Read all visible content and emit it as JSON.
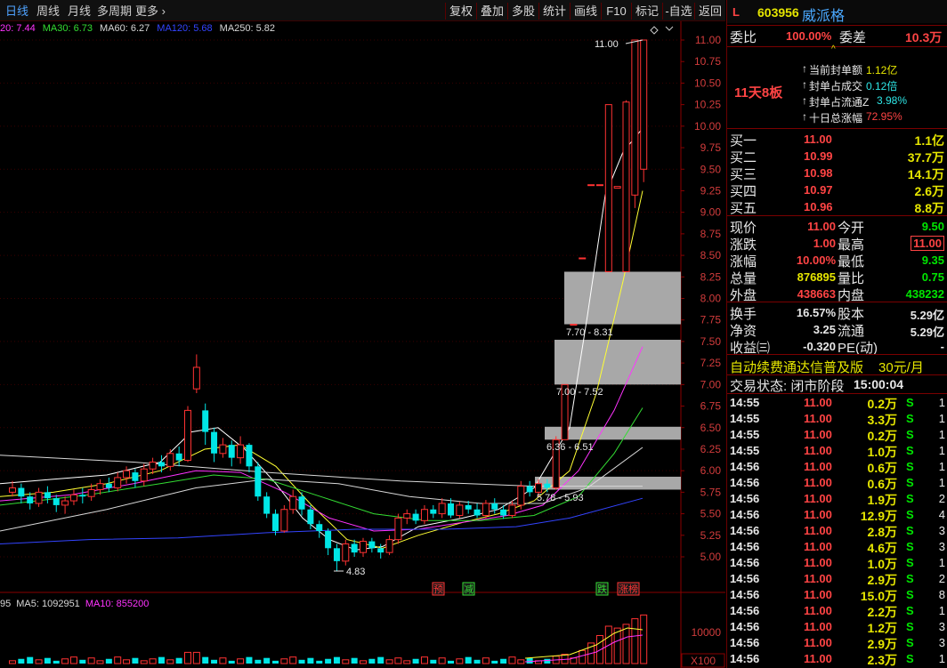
{
  "toolbar": {
    "timeframes": [
      "日线",
      "周线",
      "月线",
      "多周期",
      "更多"
    ],
    "active_timeframe": "日线",
    "more_arrow": "›",
    "buttons": [
      "复权",
      "叠加",
      "多股",
      "统计",
      "画线",
      "F10",
      "标记",
      "-自选",
      "返回"
    ]
  },
  "ma_legend": [
    {
      "label": "20: 7.44",
      "color": "#ff33ff"
    },
    {
      "label": "MA30: 6.73",
      "color": "#33dd33"
    },
    {
      "label": "MA60: 6.27",
      "color": "#d8d8d8"
    },
    {
      "label": "MA120: 5.68",
      "color": "#3344ff"
    },
    {
      "label": "MA250: 5.82",
      "color": "#d8d8d8"
    }
  ],
  "vol_legend": [
    {
      "label": "95",
      "color": "#d8d8d8"
    },
    {
      "label": "MA5: 1092951",
      "color": "#d8d8d8"
    },
    {
      "label": "MA10: 855200",
      "color": "#ff33ff"
    }
  ],
  "chart_data": {
    "type": "candlestick",
    "y_ticks": [
      "11.00",
      "10.75",
      "10.50",
      "10.25",
      "10.00",
      "9.75",
      "9.50",
      "9.25",
      "9.00",
      "8.75",
      "8.50",
      "8.25",
      "8.00",
      "7.75",
      "7.50",
      "7.25",
      "7.00",
      "6.75",
      "6.50",
      "6.25",
      "6.00",
      "5.75",
      "5.50",
      "5.25",
      "5.00"
    ],
    "ylim": [
      4.6,
      11.1
    ],
    "vol_tick": "10000",
    "vol_unit": "X100",
    "high_label": "11.00",
    "low_label": "4.83",
    "candles": [
      [
        5.75,
        5.8,
        5.7,
        5.88
      ],
      [
        5.8,
        5.7,
        5.62,
        5.85
      ],
      [
        5.7,
        5.62,
        5.55,
        5.75
      ],
      [
        5.62,
        5.75,
        5.58,
        5.8
      ],
      [
        5.75,
        5.68,
        5.62,
        5.82
      ],
      [
        5.68,
        5.6,
        5.52,
        5.72
      ],
      [
        5.6,
        5.65,
        5.5,
        5.7
      ],
      [
        5.65,
        5.72,
        5.6,
        5.78
      ],
      [
        5.72,
        5.7,
        5.62,
        5.8
      ],
      [
        5.7,
        5.78,
        5.65,
        5.85
      ],
      [
        5.78,
        5.85,
        5.72,
        5.9
      ],
      [
        5.85,
        5.8,
        5.75,
        5.92
      ],
      [
        5.8,
        5.92,
        5.76,
        5.98
      ],
      [
        5.92,
        6.0,
        5.85,
        6.05
      ],
      [
        5.98,
        5.88,
        5.8,
        6.02
      ],
      [
        5.88,
        6.02,
        5.82,
        6.08
      ],
      [
        6.02,
        6.1,
        5.96,
        6.15
      ],
      [
        6.1,
        6.05,
        5.98,
        6.18
      ],
      [
        6.05,
        6.2,
        6.0,
        6.25
      ],
      [
        6.2,
        6.12,
        6.05,
        6.28
      ],
      [
        6.12,
        6.7,
        6.1,
        6.75
      ],
      [
        6.95,
        7.2,
        6.9,
        7.35
      ],
      [
        6.7,
        6.45,
        6.3,
        6.78
      ],
      [
        6.45,
        6.2,
        6.1,
        6.5
      ],
      [
        6.2,
        6.3,
        6.15,
        6.38
      ],
      [
        6.3,
        6.15,
        6.05,
        6.35
      ],
      [
        6.15,
        6.3,
        6.08,
        6.4
      ],
      [
        6.3,
        6.05,
        5.98,
        6.32
      ],
      [
        6.05,
        5.7,
        5.65,
        6.1
      ],
      [
        5.7,
        5.5,
        5.45,
        5.75
      ],
      [
        5.5,
        5.3,
        5.25,
        5.55
      ],
      [
        5.3,
        5.55,
        5.28,
        5.6
      ],
      [
        5.55,
        5.7,
        5.5,
        5.78
      ],
      [
        5.7,
        5.55,
        5.48,
        5.75
      ],
      [
        5.55,
        5.38,
        5.32,
        5.6
      ],
      [
        5.38,
        5.3,
        5.22,
        5.42
      ],
      [
        5.3,
        5.1,
        5.02,
        5.33
      ],
      [
        5.1,
        4.95,
        4.83,
        5.15
      ],
      [
        4.95,
        5.15,
        4.9,
        5.2
      ],
      [
        5.15,
        5.05,
        5.0,
        5.2
      ],
      [
        5.05,
        5.18,
        5.0,
        5.22
      ],
      [
        5.18,
        5.1,
        5.05,
        5.22
      ],
      [
        5.1,
        5.05,
        4.98,
        5.15
      ],
      [
        5.05,
        5.2,
        5.02,
        5.25
      ],
      [
        5.2,
        5.45,
        5.15,
        5.5
      ],
      [
        5.45,
        5.5,
        5.38,
        5.55
      ],
      [
        5.5,
        5.42,
        5.38,
        5.55
      ],
      [
        5.42,
        5.55,
        5.38,
        5.6
      ],
      [
        5.55,
        5.5,
        5.45,
        5.6
      ],
      [
        5.5,
        5.62,
        5.45,
        5.68
      ],
      [
        5.62,
        5.48,
        5.45,
        5.68
      ],
      [
        5.48,
        5.6,
        5.45,
        5.64
      ],
      [
        5.6,
        5.55,
        5.5,
        5.65
      ],
      [
        5.55,
        5.48,
        5.45,
        5.62
      ],
      [
        5.48,
        5.62,
        5.44,
        5.66
      ],
      [
        5.62,
        5.55,
        5.5,
        5.68
      ],
      [
        5.55,
        5.48,
        5.44,
        5.6
      ],
      [
        5.48,
        5.6,
        5.45,
        5.65
      ],
      [
        5.6,
        5.82,
        5.55,
        5.88
      ],
      [
        5.82,
        5.75,
        5.7,
        5.88
      ],
      [
        5.75,
        5.85,
        5.7,
        5.9
      ],
      [
        5.85,
        5.8,
        5.75,
        5.9
      ],
      [
        5.8,
        6.36,
        5.78,
        6.4
      ],
      [
        6.36,
        7.0,
        6.36,
        7.0
      ],
      [
        7.7,
        7.7,
        7.7,
        7.7
      ],
      [
        8.47,
        8.47,
        8.47,
        8.47
      ],
      [
        9.32,
        9.32,
        9.32,
        9.32
      ],
      [
        9.32,
        9.32,
        9.32,
        9.32
      ],
      [
        8.31,
        10.25,
        8.31,
        10.25
      ],
      [
        9.28,
        9.3,
        9.28,
        9.3
      ],
      [
        8.31,
        10.28,
        8.31,
        10.3
      ],
      [
        9.2,
        11.0,
        9.05,
        11.0
      ],
      [
        9.5,
        11.0,
        9.35,
        11.0
      ]
    ]
  },
  "chart_annotations": {
    "box1": "7.70 - 8.31",
    "box2": "7.00 - 7.52",
    "box3": "6.36 - 6.51",
    "box4": "5.78 - 5.93",
    "markers": [
      {
        "label": "预",
        "color": "#ff3333"
      },
      {
        "label": "减",
        "color": "#33dd33"
      },
      {
        "label": "跌",
        "color": "#33dd33"
      },
      {
        "label": "涨榜",
        "color": "#ff3333"
      }
    ]
  },
  "panel": {
    "market": "L",
    "code": "603956",
    "name": "威派格",
    "weibi_label": "委比",
    "weibi_value": "100.00%",
    "weicha_label": "委差",
    "weicha_value": "10.3万",
    "streak": "11天8板",
    "seal_items": [
      {
        "label": "当前封单额",
        "value": "1.12亿",
        "color": "#e6e600"
      },
      {
        "label": "封单占成交",
        "value": "0.12倍",
        "color": "#2ee6e6"
      },
      {
        "label": "封单占流通Z",
        "value": "3.98%",
        "color": "#2ee6e6"
      },
      {
        "label": "十日总涨幅",
        "value": "72.95%",
        "color": "#ff4444"
      }
    ],
    "bids": [
      {
        "label": "买一",
        "price": "11.00",
        "vol": "1.1亿"
      },
      {
        "label": "买二",
        "price": "10.99",
        "vol": "37.7万"
      },
      {
        "label": "买三",
        "price": "10.98",
        "vol": "14.1万"
      },
      {
        "label": "买四",
        "price": "10.97",
        "vol": "2.6万"
      },
      {
        "label": "买五",
        "price": "10.96",
        "vol": "8.8万"
      }
    ],
    "quote": [
      {
        "l1": "现价",
        "v1": "11.00",
        "c1": "#ff4444",
        "l2": "今开",
        "v2": "9.50",
        "c2": "#00e600"
      },
      {
        "l1": "涨跌",
        "v1": "1.00",
        "c1": "#ff4444",
        "l2": "最高",
        "v2": "11.00",
        "c2": "#ff4444"
      },
      {
        "l1": "涨幅",
        "v1": "10.00%",
        "c1": "#ff4444",
        "l2": "最低",
        "v2": "9.35",
        "c2": "#00e600"
      },
      {
        "l1": "总量",
        "v1": "876895",
        "c1": "#e6e600",
        "l2": "量比",
        "v2": "0.75",
        "c2": "#00e600"
      },
      {
        "l1": "外盘",
        "v1": "438663",
        "c1": "#ff4444",
        "l2": "内盘",
        "v2": "438232",
        "c2": "#00e600"
      }
    ],
    "fin": [
      {
        "l1": "换手",
        "v1": "16.57%",
        "l2": "股本",
        "v2": "5.29亿"
      },
      {
        "l1": "净资",
        "v1": "3.25",
        "l2": "流通",
        "v2": "5.29亿"
      },
      {
        "l1": "收益㈢",
        "v1": "-0.320",
        "l2": "PE(动)",
        "v2": "-"
      }
    ],
    "ad": "自动续费通达信普及版",
    "ad_price": "30元/月",
    "status_label": "交易状态: 闭市阶段",
    "status_time": "15:00:04",
    "trades": [
      {
        "t": "14:55",
        "p": "11.00",
        "v": "0.2万",
        "s": "S",
        "n": "1"
      },
      {
        "t": "14:55",
        "p": "11.00",
        "v": "3.3万",
        "s": "S",
        "n": "1"
      },
      {
        "t": "14:55",
        "p": "11.00",
        "v": "0.2万",
        "s": "S",
        "n": "1"
      },
      {
        "t": "14:55",
        "p": "11.00",
        "v": "1.0万",
        "s": "S",
        "n": "1"
      },
      {
        "t": "14:56",
        "p": "11.00",
        "v": "0.6万",
        "s": "S",
        "n": "1"
      },
      {
        "t": "14:56",
        "p": "11.00",
        "v": "0.6万",
        "s": "S",
        "n": "1"
      },
      {
        "t": "14:56",
        "p": "11.00",
        "v": "1.9万",
        "s": "S",
        "n": "2"
      },
      {
        "t": "14:56",
        "p": "11.00",
        "v": "12.9万",
        "s": "S",
        "n": "4"
      },
      {
        "t": "14:56",
        "p": "11.00",
        "v": "2.8万",
        "s": "S",
        "n": "3"
      },
      {
        "t": "14:56",
        "p": "11.00",
        "v": "4.6万",
        "s": "S",
        "n": "3"
      },
      {
        "t": "14:56",
        "p": "11.00",
        "v": "1.0万",
        "s": "S",
        "n": "1"
      },
      {
        "t": "14:56",
        "p": "11.00",
        "v": "2.9万",
        "s": "S",
        "n": "2"
      },
      {
        "t": "14:56",
        "p": "11.00",
        "v": "15.0万",
        "s": "S",
        "n": "8"
      },
      {
        "t": "14:56",
        "p": "11.00",
        "v": "2.2万",
        "s": "S",
        "n": "1"
      },
      {
        "t": "14:56",
        "p": "11.00",
        "v": "1.2万",
        "s": "S",
        "n": "3"
      },
      {
        "t": "14:56",
        "p": "11.00",
        "v": "2.9万",
        "s": "S",
        "n": "3"
      },
      {
        "t": "14:56",
        "p": "11.00",
        "v": "2.3万",
        "s": "S",
        "n": "1"
      }
    ]
  }
}
